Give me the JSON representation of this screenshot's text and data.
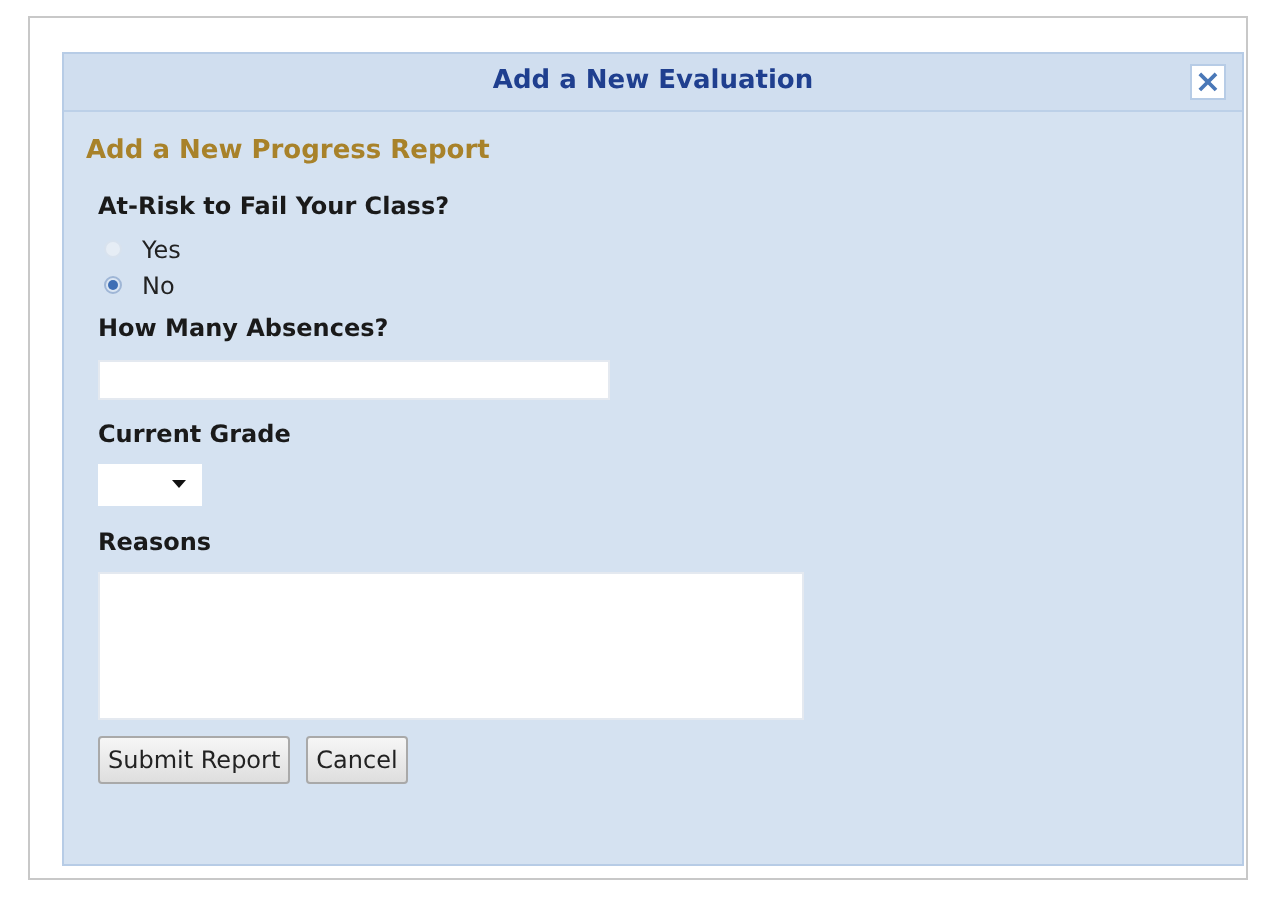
{
  "dialog": {
    "title": "Add a New Evaluation",
    "close": "×"
  },
  "form": {
    "heading": "Add a New Progress Report",
    "at_risk": {
      "label": "At-Risk to Fail Your Class?",
      "options": [
        {
          "label": "Yes",
          "selected": false
        },
        {
          "label": "No",
          "selected": true
        }
      ]
    },
    "absences": {
      "label": "How Many Absences?"
    },
    "grade": {
      "label": "Current Grade"
    },
    "reasons": {
      "label": "Reasons"
    },
    "buttons": [
      "Submit Report",
      "Cancel"
    ]
  }
}
